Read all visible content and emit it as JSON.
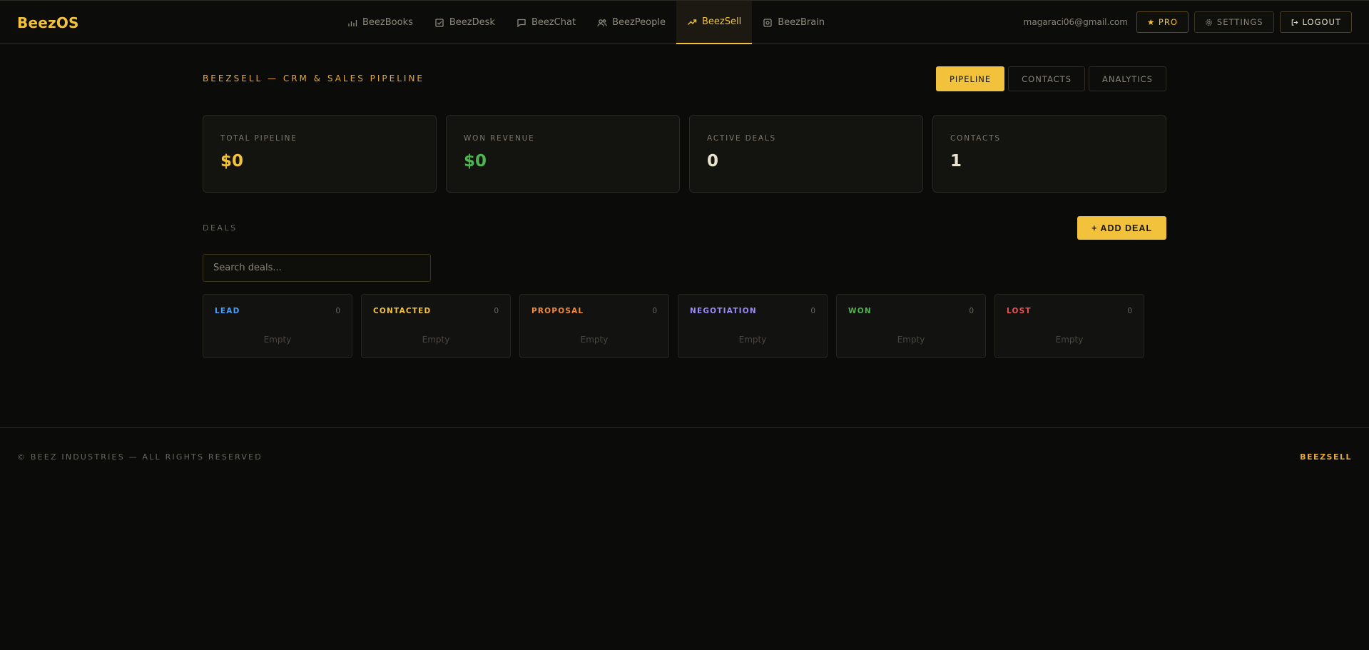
{
  "header": {
    "brand": "BeezOS",
    "nav": [
      {
        "label": "BeezBooks",
        "icon": "bar-chart-icon",
        "active": false
      },
      {
        "label": "BeezDesk",
        "icon": "check-square-icon",
        "active": false
      },
      {
        "label": "BeezChat",
        "icon": "chat-bubble-icon",
        "active": false
      },
      {
        "label": "BeezPeople",
        "icon": "users-icon",
        "active": false
      },
      {
        "label": "BeezSell",
        "icon": "trending-up-icon",
        "active": true
      },
      {
        "label": "BeezBrain",
        "icon": "brain-chip-icon",
        "active": false
      }
    ],
    "user_email": "magaraci06@gmail.com",
    "pro_label": "★ PRO",
    "settings_label": "SETTINGS",
    "logout_label": "LOGOUT"
  },
  "page": {
    "title": "BEEZSELL — CRM & SALES PIPELINE",
    "tabs": [
      "PIPELINE",
      "CONTACTS",
      "ANALYTICS"
    ],
    "active_tab": "PIPELINE"
  },
  "stats": [
    {
      "label": "TOTAL PIPELINE",
      "value": "$0"
    },
    {
      "label": "WON REVENUE",
      "value": "$0"
    },
    {
      "label": "ACTIVE DEALS",
      "value": "0"
    },
    {
      "label": "CONTACTS",
      "value": "1"
    }
  ],
  "deals": {
    "section_label": "DEALS",
    "add_label": "+ ADD DEAL",
    "search_placeholder": "Search deals...",
    "search_value": "",
    "columns": [
      {
        "title": "LEAD",
        "count": "0",
        "empty": "Empty",
        "color": "#4a9ff5"
      },
      {
        "title": "CONTACTED",
        "count": "0",
        "empty": "Empty",
        "color": "#f2c23c"
      },
      {
        "title": "PROPOSAL",
        "count": "0",
        "empty": "Empty",
        "color": "#f08a3c"
      },
      {
        "title": "NEGOTIATION",
        "count": "0",
        "empty": "Empty",
        "color": "#9a8cf5"
      },
      {
        "title": "WON",
        "count": "0",
        "empty": "Empty",
        "color": "#4fb34f"
      },
      {
        "title": "LOST",
        "count": "0",
        "empty": "Empty",
        "color": "#e85454"
      }
    ]
  },
  "footer": {
    "left": "© BEEZ INDUSTRIES — ALL RIGHTS RESERVED",
    "right": "BEEZSELL"
  },
  "colors": {
    "accent": "#f2c23c",
    "background": "#0b0b0a",
    "positive": "#4fb34f"
  }
}
